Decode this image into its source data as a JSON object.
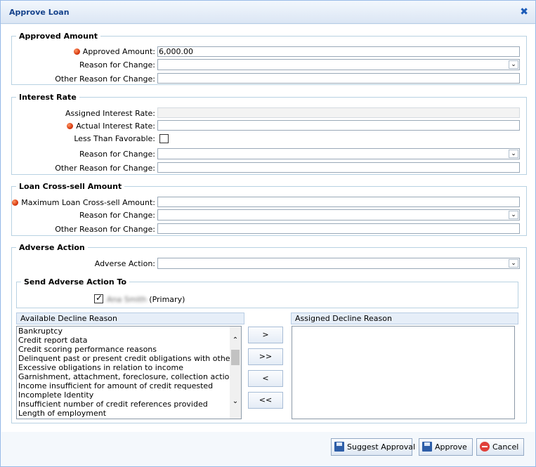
{
  "dialog": {
    "title": "Approve Loan"
  },
  "approved_amount": {
    "legend": "Approved Amount",
    "amount_label": "Approved Amount:",
    "amount_value": "6,000.00",
    "reason_label": "Reason for Change:",
    "reason_value": "",
    "other_reason_label": "Other Reason for Change:",
    "other_reason_value": ""
  },
  "interest_rate": {
    "legend": "Interest Rate",
    "assigned_label": "Assigned Interest Rate:",
    "assigned_value": "",
    "actual_label": "Actual Interest Rate:",
    "actual_value": "",
    "less_favorable_label": "Less Than Favorable:",
    "less_favorable_checked": false,
    "reason_label": "Reason for Change:",
    "reason_value": "",
    "other_reason_label": "Other Reason for Change:",
    "other_reason_value": ""
  },
  "cross_sell": {
    "legend": "Loan Cross-sell Amount",
    "max_label": "Maximum Loan Cross-sell Amount:",
    "max_value": "",
    "reason_label": "Reason for Change:",
    "reason_value": "",
    "other_reason_label": "Other Reason for Change:",
    "other_reason_value": ""
  },
  "adverse_action": {
    "legend": "Adverse Action",
    "action_label": "Adverse Action:",
    "action_value": "",
    "send_to_legend": "Send Adverse Action To",
    "recipient_name": "Ana Smith",
    "recipient_suffix": "(Primary)",
    "recipient_checked": true
  },
  "decline_reasons": {
    "available_header": "Available Decline Reason",
    "assigned_header": "Assigned Decline Reason",
    "available": [
      "Bankruptcy",
      "Credit report data",
      "Credit scoring performance reasons",
      "Delinquent past or present credit obligations with others",
      "Excessive obligations in relation to income",
      "Garnishment, attachment, foreclosure, collection action, repos",
      "Income insufficient for amount of credit requested",
      "Incomplete Identity",
      "Insufficient number of credit references provided",
      "Length of employment"
    ],
    "assigned": [],
    "move_one_right": ">",
    "move_all_right": ">>",
    "move_one_left": "<",
    "move_all_left": "<<"
  },
  "footer": {
    "suggest_label": "Suggest Approval",
    "approve_label": "Approve",
    "cancel_label": "Cancel"
  },
  "colors": {
    "title_text": "#15428b",
    "required_dot": "#d83a10",
    "group_border": "#b8d2e2"
  },
  "icons": {
    "close": "close-icon",
    "required": "required-indicator-icon",
    "dropdown": "chevron-down-icon",
    "save": "floppy-disk-icon",
    "cancel": "cancel-circle-icon"
  }
}
